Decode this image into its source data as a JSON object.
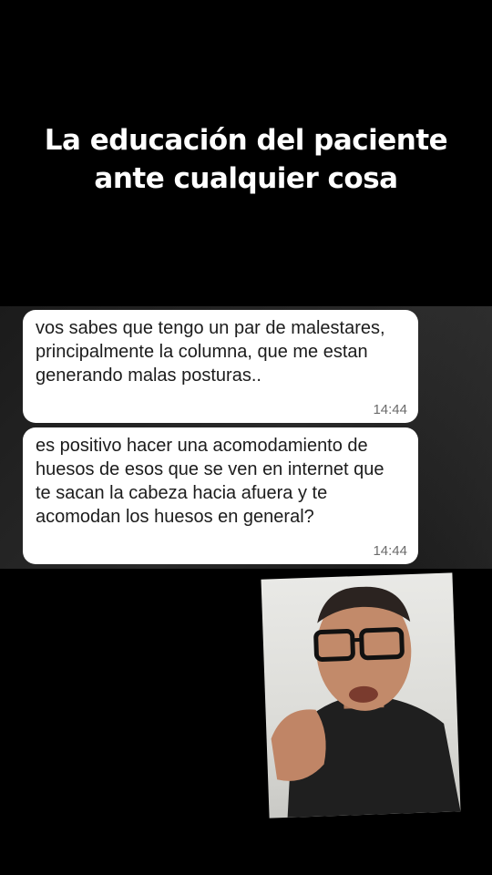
{
  "title": {
    "line1": "La educación del paciente",
    "line2": "ante cualquier cosa"
  },
  "messages": [
    {
      "text": "vos sabes que tengo un par de malestares, principalmente la columna, que me estan generando malas posturas..",
      "time": "14:44"
    },
    {
      "text": "es positivo hacer una acomodamiento de huesos de esos que se ven en internet que te sacan la cabeza hacia afuera y te acomodan los huesos en general?",
      "time": "14:44"
    }
  ],
  "colors": {
    "background": "#000000",
    "bubble": "#ffffff",
    "timestamp": "#6b6b6b",
    "title_text": "#ffffff"
  }
}
